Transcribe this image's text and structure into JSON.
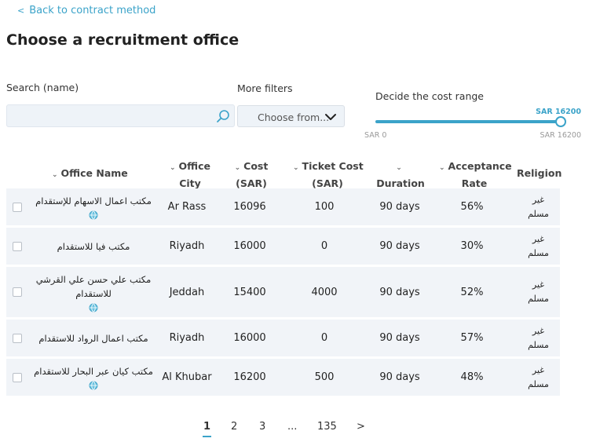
{
  "back_link": {
    "label": "Back to contract method",
    "icon": "chevron-left-icon"
  },
  "page_title": "Choose a recruitment office",
  "filters": {
    "search_label": "Search (name)",
    "search_value": "",
    "more_filters_label": "More filters",
    "more_filters_value": "Choose from...",
    "cost_range_label": "Decide the cost range",
    "cost_min_label": "SAR 0",
    "cost_max_label": "SAR 16200",
    "cost_selected_label": "SAR 16200",
    "cost_selected_fraction": 1.0
  },
  "table": {
    "headers": {
      "office_name": "Office Name",
      "office_city_1": "Office",
      "office_city_2": "City",
      "cost_1": "Cost",
      "cost_2": "(SAR)",
      "ticket_1": "Ticket Cost",
      "ticket_2": "(SAR)",
      "duration": "Duration",
      "acceptance_1": "Acceptance",
      "acceptance_2": "Rate",
      "religion": "Religion"
    },
    "rows": [
      {
        "name_1": "مكتب اعمال الاسهام للإستقدام",
        "name_2": "",
        "has_link": true,
        "city": "Ar Rass",
        "cost": "16096",
        "ticket": "100",
        "duration": "90 days",
        "acceptance": "56%",
        "religion_1": "غير",
        "religion_2": "مسلم"
      },
      {
        "name_1": "مكتب فيا للاستقدام",
        "name_2": "",
        "has_link": false,
        "city": "Riyadh",
        "cost": "16000",
        "ticket": "0",
        "duration": "90 days",
        "acceptance": "30%",
        "religion_1": "غير",
        "religion_2": "مسلم"
      },
      {
        "name_1": "مكتب علي حسن علي القرشي",
        "name_2": "للاستقدام",
        "has_link": true,
        "city": "Jeddah",
        "cost": "15400",
        "ticket": "4000",
        "duration": "90 days",
        "acceptance": "52%",
        "religion_1": "غير",
        "religion_2": "مسلم"
      },
      {
        "name_1": "مكتب اعمال الرواد للاستقدام",
        "name_2": "",
        "has_link": false,
        "city": "Riyadh",
        "cost": "16000",
        "ticket": "0",
        "duration": "90 days",
        "acceptance": "57%",
        "religion_1": "غير",
        "religion_2": "مسلم"
      },
      {
        "name_1": "مكتب كيان عبر البحار للاستقدام",
        "name_2": "",
        "has_link": true,
        "city": "Al Khubar",
        "cost": "16200",
        "ticket": "500",
        "duration": "90 days",
        "acceptance": "48%",
        "religion_1": "غير",
        "religion_2": "مسلم"
      }
    ]
  },
  "pagination": {
    "pages": [
      "1",
      "2",
      "3",
      "...",
      "135"
    ],
    "next": ">",
    "current": "1"
  },
  "colors": {
    "accent": "#3ba3c9",
    "row_bg": "#f1f4f8",
    "input_bg": "#eef3f8"
  }
}
